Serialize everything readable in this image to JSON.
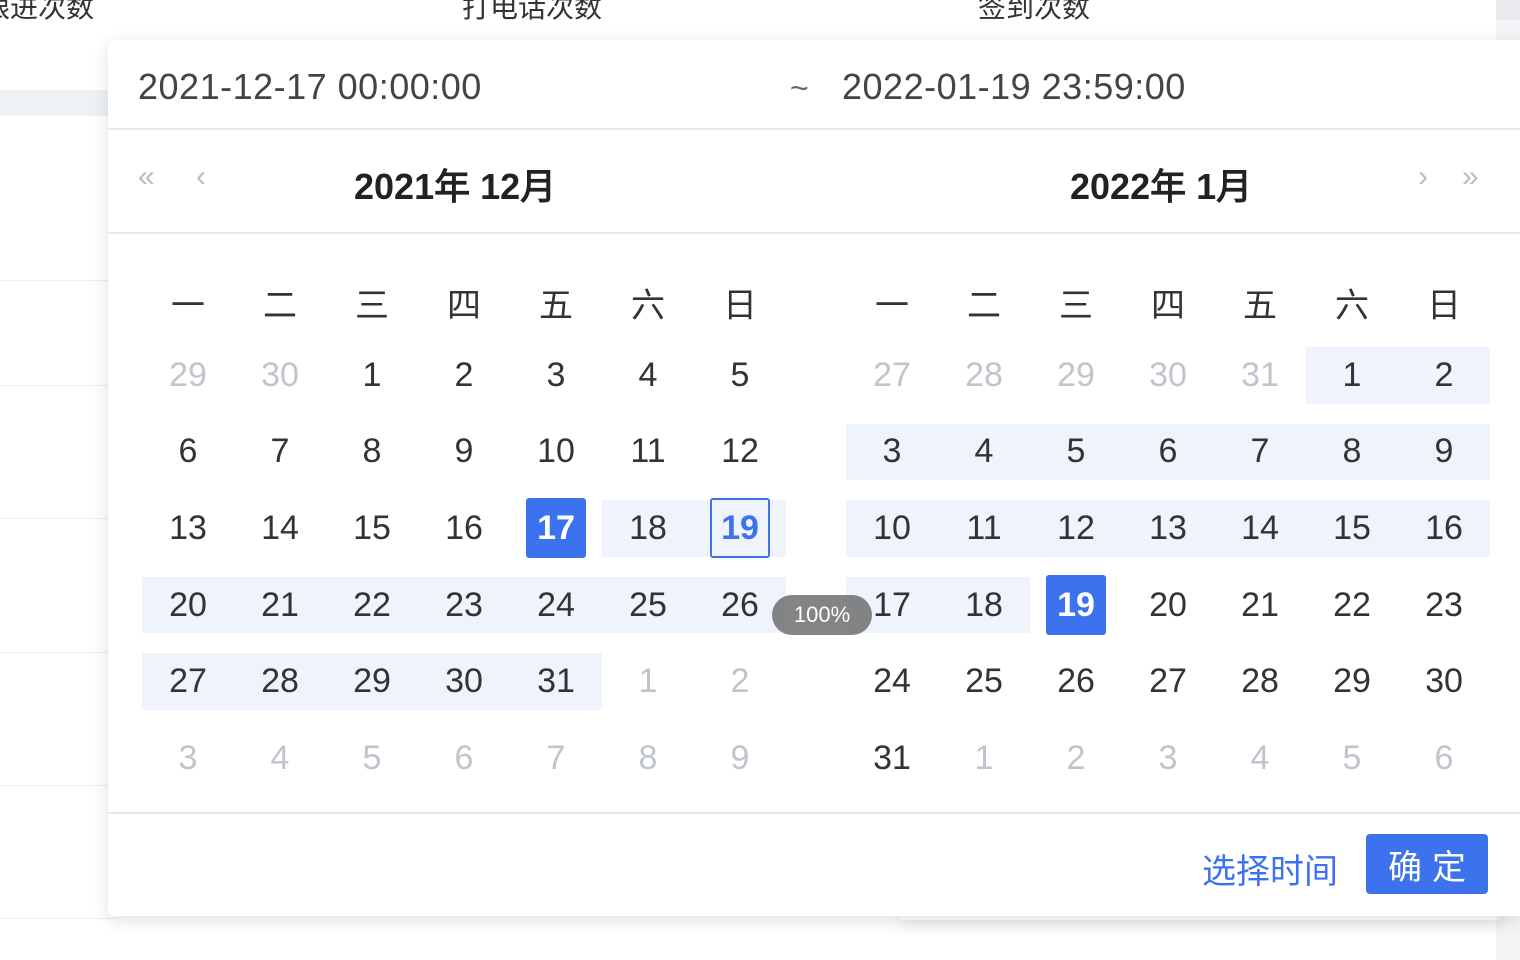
{
  "background": {
    "columns": [
      "跟进次数",
      "打电话次数",
      "签到次数"
    ]
  },
  "picker": {
    "range_start": "2021-12-17 00:00:00",
    "range_separator": "~",
    "range_end": "2022-01-19 23:59:00",
    "nav": {
      "prev_year": "«",
      "prev_month": "‹",
      "next_month": "›",
      "next_year": "»"
    },
    "left_title": "2021年 12月",
    "right_title": "2022年 1月",
    "weekdays": [
      "一",
      "二",
      "三",
      "四",
      "五",
      "六",
      "日"
    ],
    "left_days": [
      {
        "d": "29",
        "muted": true
      },
      {
        "d": "30",
        "muted": true
      },
      {
        "d": "1"
      },
      {
        "d": "2"
      },
      {
        "d": "3"
      },
      {
        "d": "4"
      },
      {
        "d": "5"
      },
      {
        "d": "6"
      },
      {
        "d": "7"
      },
      {
        "d": "8"
      },
      {
        "d": "9"
      },
      {
        "d": "10"
      },
      {
        "d": "11"
      },
      {
        "d": "12"
      },
      {
        "d": "13"
      },
      {
        "d": "14"
      },
      {
        "d": "15"
      },
      {
        "d": "16"
      },
      {
        "d": "17",
        "selected": true
      },
      {
        "d": "18",
        "range": true
      },
      {
        "d": "19",
        "range": true,
        "outline": true
      },
      {
        "d": "20",
        "range": true
      },
      {
        "d": "21",
        "range": true
      },
      {
        "d": "22",
        "range": true
      },
      {
        "d": "23",
        "range": true
      },
      {
        "d": "24",
        "range": true
      },
      {
        "d": "25",
        "range": true
      },
      {
        "d": "26",
        "range": true
      },
      {
        "d": "27",
        "range": true
      },
      {
        "d": "28",
        "range": true
      },
      {
        "d": "29",
        "range": true
      },
      {
        "d": "30",
        "range": true
      },
      {
        "d": "31",
        "range": true
      },
      {
        "d": "1",
        "muted": true
      },
      {
        "d": "2",
        "muted": true
      },
      {
        "d": "3",
        "muted": true
      },
      {
        "d": "4",
        "muted": true
      },
      {
        "d": "5",
        "muted": true
      },
      {
        "d": "6",
        "muted": true
      },
      {
        "d": "7",
        "muted": true
      },
      {
        "d": "8",
        "muted": true
      },
      {
        "d": "9",
        "muted": true
      }
    ],
    "right_days": [
      {
        "d": "27",
        "muted": true
      },
      {
        "d": "28",
        "muted": true
      },
      {
        "d": "29",
        "muted": true
      },
      {
        "d": "30",
        "muted": true
      },
      {
        "d": "31",
        "muted": true
      },
      {
        "d": "1",
        "range": true
      },
      {
        "d": "2",
        "range": true
      },
      {
        "d": "3",
        "range": true
      },
      {
        "d": "4",
        "range": true
      },
      {
        "d": "5",
        "range": true
      },
      {
        "d": "6",
        "range": true
      },
      {
        "d": "7",
        "range": true
      },
      {
        "d": "8",
        "range": true
      },
      {
        "d": "9",
        "range": true
      },
      {
        "d": "10",
        "range": true
      },
      {
        "d": "11",
        "range": true
      },
      {
        "d": "12",
        "range": true
      },
      {
        "d": "13",
        "range": true
      },
      {
        "d": "14",
        "range": true
      },
      {
        "d": "15",
        "range": true
      },
      {
        "d": "16",
        "range": true
      },
      {
        "d": "17",
        "range": true
      },
      {
        "d": "18",
        "range": true
      },
      {
        "d": "19",
        "selected": true
      },
      {
        "d": "20"
      },
      {
        "d": "21"
      },
      {
        "d": "22"
      },
      {
        "d": "23"
      },
      {
        "d": "24"
      },
      {
        "d": "25"
      },
      {
        "d": "26"
      },
      {
        "d": "27"
      },
      {
        "d": "28"
      },
      {
        "d": "29"
      },
      {
        "d": "30"
      },
      {
        "d": "31"
      },
      {
        "d": "1",
        "muted": true
      },
      {
        "d": "2",
        "muted": true
      },
      {
        "d": "3",
        "muted": true
      },
      {
        "d": "4",
        "muted": true
      },
      {
        "d": "5",
        "muted": true
      },
      {
        "d": "6",
        "muted": true
      }
    ],
    "footer": {
      "pick_time": "选择时间",
      "confirm": "确定"
    }
  },
  "zoom": "100%",
  "colors": {
    "accent": "#3d72ee",
    "range_bg": "#eef3fc",
    "muted_text": "#c0c4cc"
  }
}
